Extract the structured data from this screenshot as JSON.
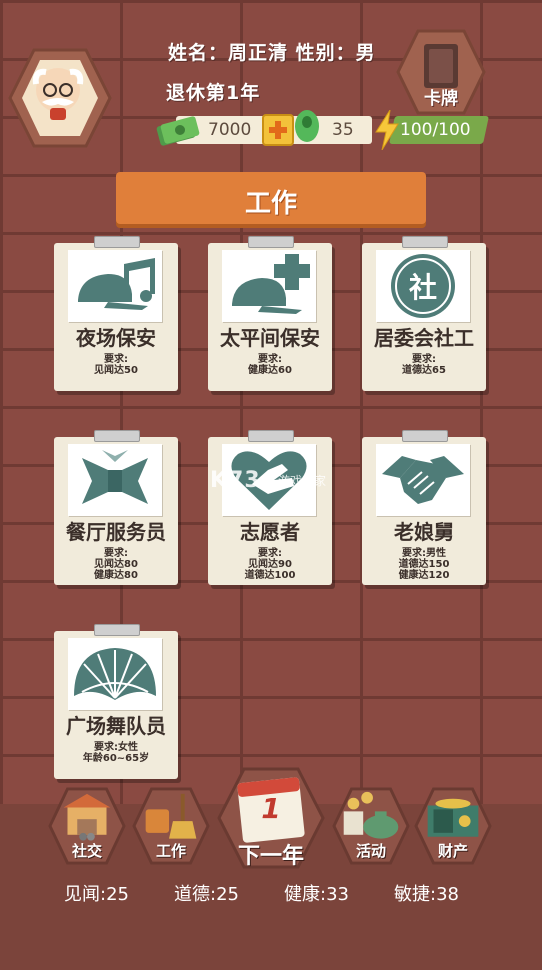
{
  "player": {
    "name_line": "姓名：周正清  性别：男",
    "status": "退休第1年"
  },
  "card_pack_label": "卡牌",
  "resources": {
    "money": "7000",
    "gems": "35",
    "energy": "100/100"
  },
  "section_title": "工作",
  "jobs": [
    {
      "title": "夜场保安",
      "req1": "要求:",
      "req2": "见闻达50",
      "req3": "",
      "icon": "cap-music-icon"
    },
    {
      "title": "太平间保安",
      "req1": "要求:",
      "req2": "健康达60",
      "req3": "",
      "icon": "cap-cross-icon"
    },
    {
      "title": "居委会社工",
      "req1": "要求:",
      "req2": "道德达65",
      "req3": "",
      "icon": "community-badge-icon",
      "badge": "社"
    },
    {
      "title": "餐厅服务员",
      "req1": "要求:",
      "req2": "见闻达80",
      "req3": "健康达80",
      "icon": "bowtie-icon"
    },
    {
      "title": "志愿者",
      "req1": "要求:",
      "req2": "见闻达90",
      "req3": "道德达100",
      "icon": "heart-hand-icon"
    },
    {
      "title": "老娘舅",
      "req1": "要求:男性",
      "req2": "道德达150",
      "req3": "健康达120",
      "icon": "handshake-icon"
    },
    {
      "title": "广场舞队员",
      "req1": "要求:女性",
      "req2": "年龄60~65岁",
      "req3": "",
      "icon": "fan-icon"
    }
  ],
  "watermark": {
    "logo": "K73",
    "text": "游戏之家"
  },
  "nav": {
    "social": "社交",
    "work": "工作",
    "next_year": "下一年",
    "calendar_day": "1",
    "activity": "活动",
    "assets": "财产"
  },
  "stats": {
    "knowledge": "见闻:25",
    "morality": "道德:25",
    "health": "健康:33",
    "agility": "敏捷:38"
  },
  "colors": {
    "brick": "#8a4a42",
    "mortar": "#6f3a33",
    "banner": "#e07f3a",
    "card": "#f1ebdb",
    "icon_teal": "#4f7c78",
    "panel": "#7b443b"
  }
}
